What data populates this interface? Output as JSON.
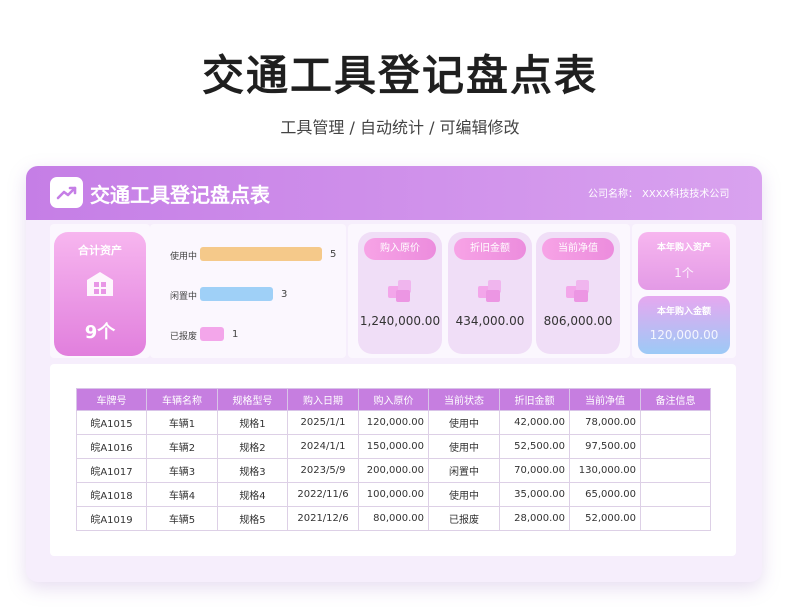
{
  "page": {
    "title": "交通工具登记盘点表",
    "subtitle": "工具管理 /  自动统计 /  可编辑修改"
  },
  "card": {
    "title": "交通工具登记盘点表",
    "company_label": "公司名称：",
    "company_value": "XXXX科技技术公司"
  },
  "summary": {
    "total_label": "合计资产",
    "total_value": "9个"
  },
  "status_bars": [
    {
      "label": "使用中",
      "value": "5",
      "fraction": 1.0,
      "color": "#f5c98a"
    },
    {
      "label": "闲置中",
      "value": "3",
      "fraction": 0.6,
      "color": "#9fd0f7"
    },
    {
      "label": "已报废",
      "value": "1",
      "fraction": 0.2,
      "color": "#f3a6ea"
    }
  ],
  "stats": [
    {
      "label": "购入原价",
      "value": "1,240,000.00"
    },
    {
      "label": "折旧金额",
      "value": "434,000.00"
    },
    {
      "label": "当前净值",
      "value": "806,000.00"
    }
  ],
  "year": {
    "assets_label": "本年购入资产",
    "assets_value": "1个",
    "amount_label": "本年购入金额",
    "amount_value": "120,000.00"
  },
  "table": {
    "headers": [
      "车牌号",
      "车辆名称",
      "规格型号",
      "购入日期",
      "购入原价",
      "当前状态",
      "折旧金额",
      "当前净值",
      "备注信息"
    ],
    "rows": [
      [
        "皖A1015",
        "车辆1",
        "规格1",
        "2025/1/1",
        "120,000.00",
        "使用中",
        "42,000.00",
        "78,000.00",
        ""
      ],
      [
        "皖A1016",
        "车辆2",
        "规格2",
        "2024/1/1",
        "150,000.00",
        "使用中",
        "52,500.00",
        "97,500.00",
        ""
      ],
      [
        "皖A1017",
        "车辆3",
        "规格3",
        "2023/5/9",
        "200,000.00",
        "闲置中",
        "70,000.00",
        "130,000.00",
        ""
      ],
      [
        "皖A1018",
        "车辆4",
        "规格4",
        "2022/11/6",
        "100,000.00",
        "使用中",
        "35,000.00",
        "65,000.00",
        ""
      ],
      [
        "皖A1019",
        "车辆5",
        "规格5",
        "2021/12/6",
        "80,000.00",
        "已报废",
        "28,000.00",
        "52,000.00",
        ""
      ]
    ]
  },
  "icons": {
    "logo": "trend-up-icon",
    "total": "house-grid-icon",
    "stat": "coins-stack-icon"
  }
}
